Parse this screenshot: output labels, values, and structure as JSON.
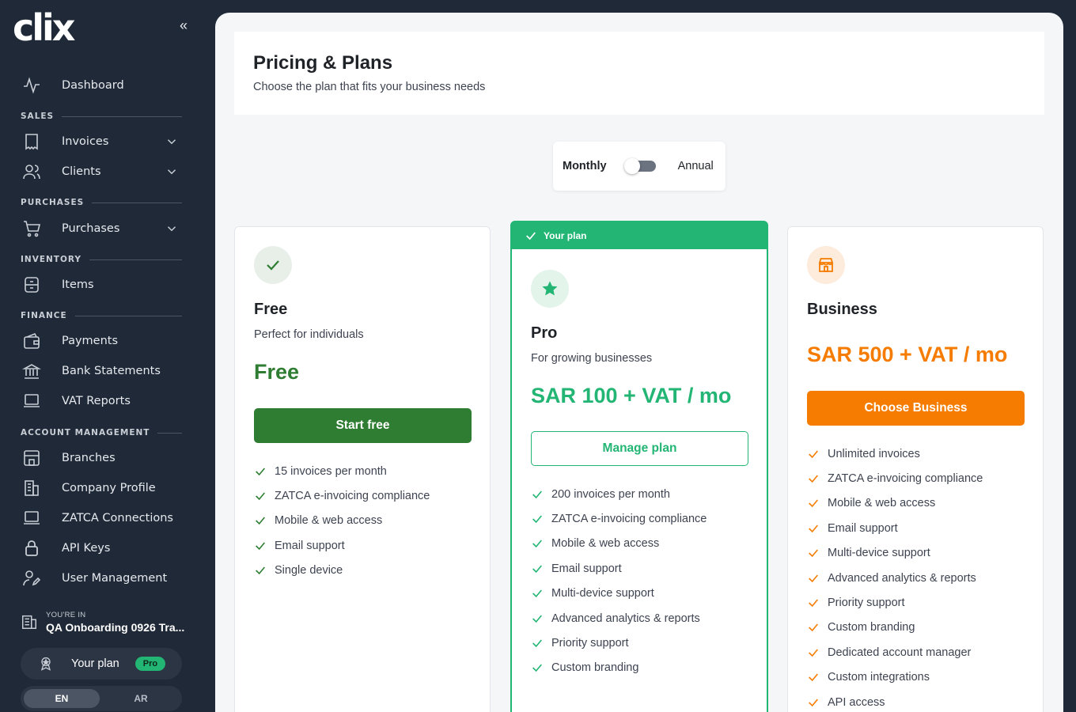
{
  "brand": {
    "logo_text": "clix"
  },
  "sidebar": {
    "collapse_icon": "«",
    "dashboard": "Dashboard",
    "sections": {
      "sales": "SALES",
      "purchases": "PURCHASES",
      "inventory": "INVENTORY",
      "finance": "FINANCE",
      "account": "ACCOUNT MANAGEMENT"
    },
    "items": {
      "invoices": "Invoices",
      "clients": "Clients",
      "purchases": "Purchases",
      "items": "Items",
      "payments": "Payments",
      "bank_statements": "Bank Statements",
      "vat_reports": "VAT Reports",
      "branches": "Branches",
      "company_profile": "Company Profile",
      "zatca_connections": "ZATCA Connections",
      "api_keys": "API Keys",
      "user_management": "User Management"
    },
    "workspace": {
      "caption": "YOU'RE IN",
      "name": "QA Onboarding 0926 Tra..."
    },
    "plan": {
      "label": "Your plan",
      "badge": "Pro"
    },
    "language": {
      "en": "EN",
      "ar": "AR",
      "active": "EN"
    }
  },
  "header": {
    "title": "Pricing & Plans",
    "subtitle": "Choose the plan that fits your business needs"
  },
  "billing": {
    "monthly": "Monthly",
    "annual": "Annual",
    "selected": "Monthly"
  },
  "plans": {
    "free": {
      "name": "Free",
      "subtitle": "Perfect for individuals",
      "price": "Free",
      "button": "Start free",
      "features": [
        "15 invoices per month",
        "ZATCA e-invoicing compliance",
        "Mobile & web access",
        "Email support",
        "Single device"
      ]
    },
    "pro": {
      "banner": "Your plan",
      "name": "Pro",
      "subtitle": "For growing businesses",
      "price": "SAR 100 + VAT / mo",
      "button": "Manage plan",
      "features": [
        "200 invoices per month",
        "ZATCA e-invoicing compliance",
        "Mobile & web access",
        "Email support",
        "Multi-device support",
        "Advanced analytics & reports",
        "Priority support",
        "Custom branding"
      ]
    },
    "business": {
      "name": "Business",
      "price": "SAR 500 + VAT / mo",
      "button": "Choose Business",
      "features": [
        "Unlimited invoices",
        "ZATCA e-invoicing compliance",
        "Mobile & web access",
        "Email support",
        "Multi-device support",
        "Advanced analytics & reports",
        "Priority support",
        "Custom branding",
        "Dedicated account manager",
        "Custom integrations",
        "API access"
      ]
    }
  },
  "colors": {
    "sidebar_bg": "#1f2937",
    "free_green": "#2e7d32",
    "pro_green": "#22b573",
    "business_orange": "#f57c00"
  }
}
